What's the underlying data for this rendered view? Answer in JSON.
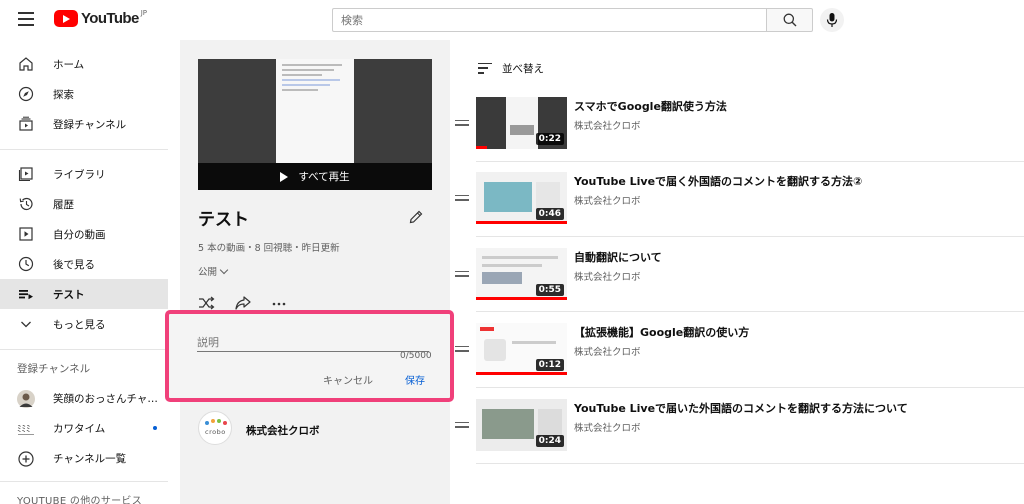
{
  "header": {
    "logo_text": "YouTube",
    "logo_region": "JP",
    "search_placeholder": "検索",
    "icons": [
      "menu-icon",
      "search-icon",
      "mic-icon"
    ]
  },
  "sidebar": {
    "main_items": [
      {
        "label": "ホーム",
        "icon": "home-icon"
      },
      {
        "label": "探索",
        "icon": "compass-icon"
      },
      {
        "label": "登録チャンネル",
        "icon": "subscriptions-icon"
      }
    ],
    "library_items": [
      {
        "label": "ライブラリ",
        "icon": "library-icon"
      },
      {
        "label": "履歴",
        "icon": "history-icon"
      },
      {
        "label": "自分の動画",
        "icon": "my-videos-icon"
      },
      {
        "label": "後で見る",
        "icon": "clock-icon"
      },
      {
        "label": "テスト",
        "icon": "playlist-icon",
        "active": true
      },
      {
        "label": "もっと見る",
        "icon": "chevron-down-icon"
      }
    ],
    "subscriptions_title": "登録チャンネル",
    "subscriptions": [
      {
        "label": "笑顔のおっさんチャ…"
      },
      {
        "label": "カワタイム",
        "new_content": true
      },
      {
        "label": "チャンネル一覧",
        "icon": "add-circle-icon"
      }
    ],
    "more_services_title": "YOUTUBE の他のサービス"
  },
  "playlist": {
    "play_all_label": "すべて再生",
    "title": "テスト",
    "stats": "5 本の動画・8 回視聴・昨日更新",
    "privacy": "公開",
    "description_placeholder": "説明",
    "description_counter": "0/5000",
    "cancel_label": "キャンセル",
    "save_label": "保存",
    "owner_name": "株式会社クロボ",
    "owner_logo_text": "crobo"
  },
  "list": {
    "sort_label": "並べ替え",
    "videos": [
      {
        "title": "スマホでGoogle翻訳使う方法",
        "channel": "株式会社クロボ",
        "duration": "0:22",
        "progress": 0.12
      },
      {
        "title": "YouTube Liveで届く外国語のコメントを翻訳する方法②",
        "channel": "株式会社クロボ",
        "duration": "0:46",
        "progress": 1.0
      },
      {
        "title": "自動翻訳について",
        "channel": "株式会社クロボ",
        "duration": "0:55",
        "progress": 1.0
      },
      {
        "title": "【拡張機能】Google翻訳の使い方",
        "channel": "株式会社クロボ",
        "duration": "0:12",
        "progress": 1.0
      },
      {
        "title": "YouTube Liveで届いた外国語のコメントを翻訳する方法について",
        "channel": "株式会社クロボ",
        "duration": "0:24",
        "progress": 0
      }
    ]
  },
  "colors": {
    "highlight_border": "#f0407a",
    "accent_blue": "#065fd4",
    "brand_red": "#ff0000"
  }
}
